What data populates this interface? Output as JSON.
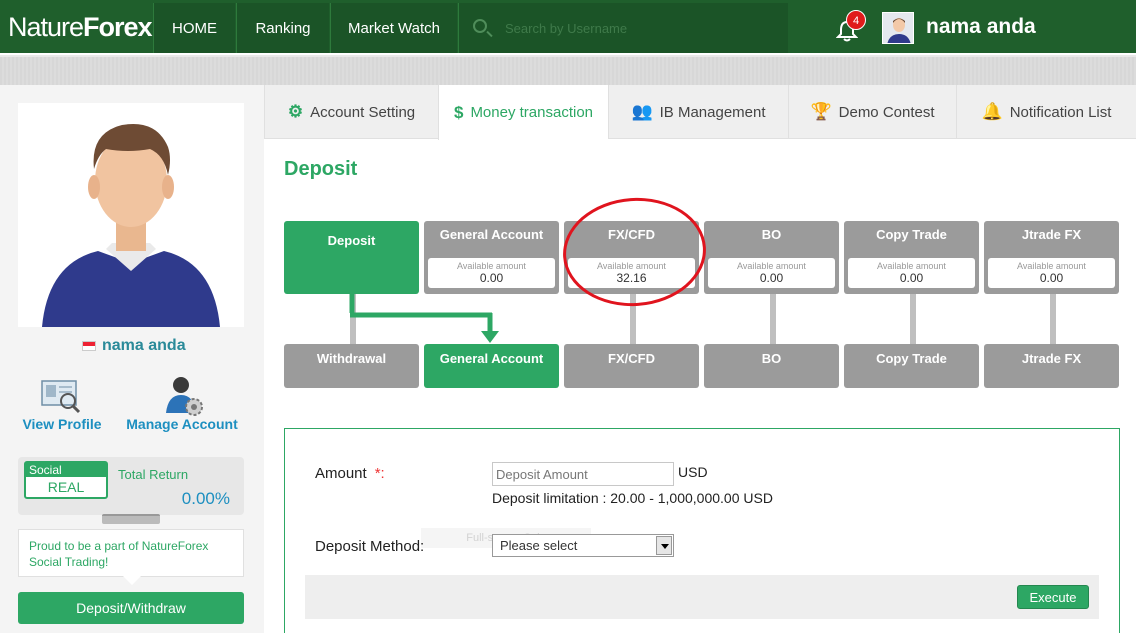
{
  "header": {
    "logo_light": "Nature",
    "logo_bold": "Forex",
    "nav": [
      "HOME",
      "Ranking",
      "Market Watch"
    ],
    "search_placeholder": "Search by Username",
    "notification_count": "4",
    "username": "nama anda"
  },
  "sidebar": {
    "profile_name": "nama anda",
    "view_profile": "View Profile",
    "manage_account": "Manage Account",
    "social_label": "Social",
    "social_type": "REAL",
    "total_return_label": "Total Return",
    "total_return_value": "0.00%",
    "tagline": "Proud to be a part of NatureForex Social Trading!",
    "deposit_withdraw": "Deposit/Withdraw"
  },
  "tabs": [
    "Account Setting",
    "Money transaction",
    "IB Management",
    "Demo Contest",
    "Notification List"
  ],
  "page_title": "Deposit",
  "accounts_top": {
    "first": "Deposit",
    "available_label": "Available amount",
    "items": [
      {
        "name": "General Account",
        "amount": "0.00"
      },
      {
        "name": "FX/CFD",
        "amount": "32.16"
      },
      {
        "name": "BO",
        "amount": "0.00"
      },
      {
        "name": "Copy Trade",
        "amount": "0.00"
      },
      {
        "name": "Jtrade FX",
        "amount": "0.00"
      }
    ]
  },
  "accounts_bottom": [
    "Withdrawal",
    "General Account",
    "FX/CFD",
    "BO",
    "Copy Trade",
    "Jtrade FX"
  ],
  "form": {
    "amount_label": "Amount",
    "required_mark": "*:",
    "amount_placeholder": "Deposit Amount",
    "currency": "USD",
    "limitation": "Deposit limitation : 20.00 - 1,000,000.00 USD",
    "method_label": "Deposit Method:",
    "method_value": "Please select",
    "ghost_text": "Full-screen Snip",
    "execute": "Execute"
  },
  "colors": {
    "brand_green": "#2da764",
    "header_green": "#1f5f2c",
    "highlight_red": "#e0141e"
  }
}
